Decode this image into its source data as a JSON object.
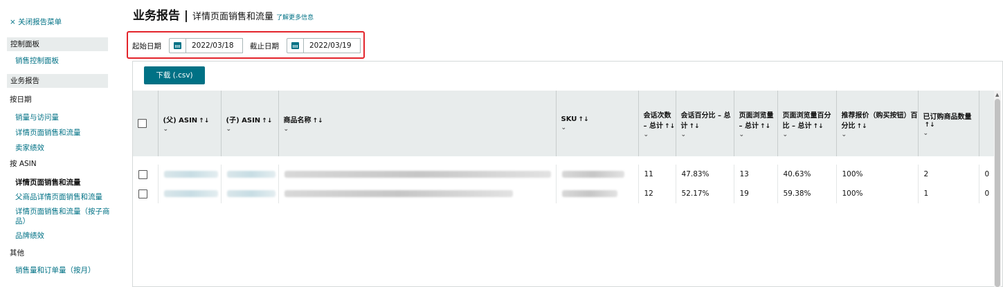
{
  "sidebar": {
    "close_menu": "× 关闭报告菜单",
    "dashboard_head": "控制面板",
    "sales_dashboard": "销售控制面板",
    "reports_head": "业务报告",
    "by_date": "按日期",
    "by_date_items": [
      "销量与访问量",
      "详情页面销售和流量",
      "卖家绩效"
    ],
    "by_asin": "按 ASIN",
    "by_asin_items": [
      "详情页面销售和流量",
      "父商品详情页面销售和流量",
      "详情页面销售和流量（按子商品）",
      "品牌绩效"
    ],
    "other": "其他",
    "other_items": [
      "销售量和订单量（按月）"
    ]
  },
  "header": {
    "title": "业务报告",
    "divider": " | ",
    "subtitle": "详情页面销售和流量",
    "learn_more": "了解更多信息"
  },
  "dates": {
    "start_label": "起始日期",
    "start_value": "2022/03/18",
    "end_label": "截止日期",
    "end_value": "2022/03/19"
  },
  "download_label": "下载 (.csv)",
  "table": {
    "columns": [
      "(父) ASIN",
      "(子) ASIN",
      "商品名称",
      "SKU",
      "会话次数 – 总计",
      "会话百分比 – 总计",
      "页面浏览量 – 总计",
      "页面浏览量百分比 – 总计",
      "推荐报价（购买按钮）百分比",
      "已订购商品数量"
    ],
    "rows": [
      {
        "sessions": "11",
        "session_pct": "47.83%",
        "page_views": "13",
        "pv_pct": "40.63%",
        "buybox": "100%",
        "units": "2",
        "next": "0"
      },
      {
        "sessions": "12",
        "session_pct": "52.17%",
        "page_views": "19",
        "pv_pct": "59.38%",
        "buybox": "100%",
        "units": "1",
        "next": "0"
      }
    ]
  },
  "colors": {
    "accent": "#007185",
    "highlight_border": "#e3242b",
    "header_bg": "#e8ecec"
  }
}
